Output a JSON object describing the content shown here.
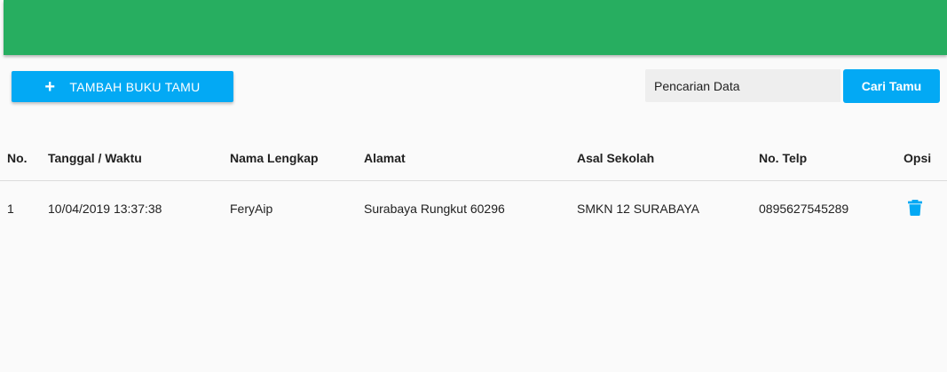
{
  "header": {
    "accent_color": "#27ae60"
  },
  "toolbar": {
    "add_plus": "+",
    "add_label": "TAMBAH BUKU TAMU",
    "search_placeholder": "Pencarian Data",
    "search_button_label": "Cari Tamu",
    "button_color": "#03a9f4"
  },
  "table": {
    "headers": [
      "No.",
      "Tanggal / Waktu",
      "Nama Lengkap",
      "Alamat",
      "Asal Sekolah",
      "No. Telp",
      "Opsi"
    ],
    "rows": [
      {
        "no": "1",
        "datetime": "10/04/2019 13:37:38",
        "name": "FeryAip",
        "address": "Surabaya Rungkut 60296",
        "school": "SMKN 12 SURABAYA",
        "phone": "0895627545289",
        "action_icon": "trash-icon"
      }
    ]
  }
}
